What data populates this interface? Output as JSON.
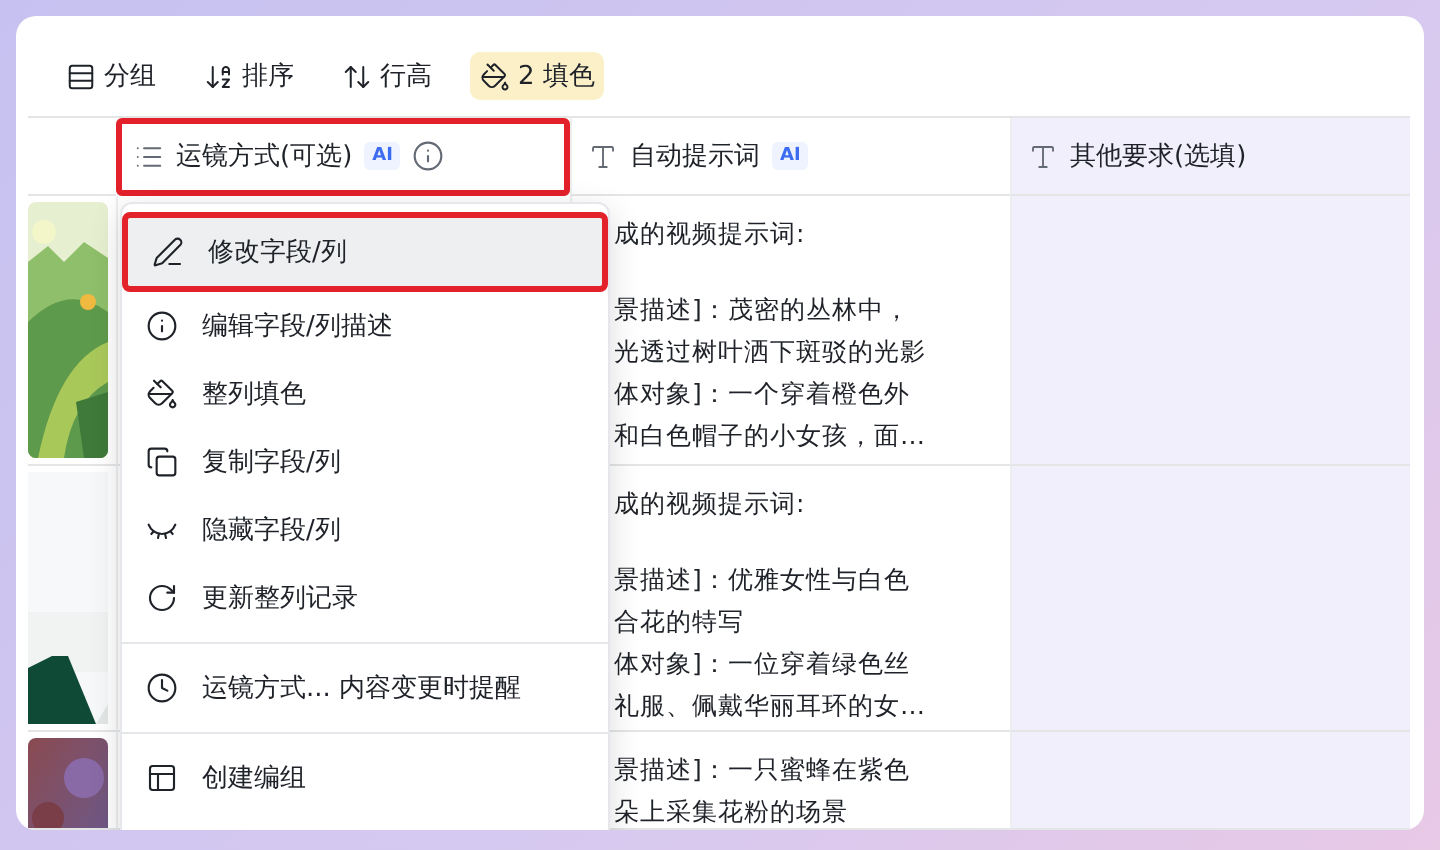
{
  "toolbar": [
    {
      "label": "分组",
      "kind": "group",
      "active": false
    },
    {
      "label": "排序",
      "kind": "sort",
      "active": false
    },
    {
      "label": "行高",
      "kind": "height",
      "active": false
    },
    {
      "label": "2 填色",
      "kind": "fill",
      "active": true
    }
  ],
  "columns": [
    {
      "label": "运镜方式(可选)",
      "kind": "options",
      "badge": "AI",
      "info": true,
      "annotated": true,
      "tinted": false
    },
    {
      "label": "自动提示词",
      "kind": "text",
      "badge": "AI",
      "info": false,
      "annotated": false,
      "tinted": false
    },
    {
      "label": "其他要求(选填)",
      "kind": "text",
      "info": false,
      "annotated": false,
      "tinted": true
    }
  ],
  "rows": [
    {
      "thumbnail": {
        "kind": "picture"
      },
      "prompt": [
        [
          "成的视频提示词:"
        ],
        [
          "景描述]：茂密的丛林中，",
          "光透过树叶洒下斑驳的光影",
          "体对象]：一个穿着橙色外",
          "和白色帽子的小女孩，面…"
        ]
      ]
    },
    {
      "thumbnail": {
        "kind": "picture"
      },
      "prompt": [
        [
          "成的视频提示词:"
        ],
        [
          "景描述]：优雅女性与白色",
          "合花的特写",
          "体对象]：一位穿着绿色丝",
          "礼服、佩戴华丽耳环的女…"
        ]
      ]
    },
    {
      "thumbnail": {
        "kind": "picture"
      },
      "prompt": [
        [
          "景描述]：一只蜜蜂在紫色",
          "朵上采集花粉的场景"
        ]
      ]
    }
  ],
  "menu": {
    "items": [
      {
        "label": "修改字段/列",
        "kind": "edit",
        "highlighted": true,
        "annotated": true,
        "divider_before": false
      },
      {
        "label": "编辑字段/列描述",
        "kind": "info",
        "highlighted": false,
        "annotated": false,
        "divider_before": false
      },
      {
        "label": "整列填色",
        "kind": "fill",
        "highlighted": false,
        "annotated": false,
        "divider_before": false
      },
      {
        "label": "复制字段/列",
        "kind": "copy",
        "highlighted": false,
        "annotated": false,
        "divider_before": false
      },
      {
        "label": "隐藏字段/列",
        "kind": "hide",
        "highlighted": false,
        "annotated": false,
        "divider_before": false
      },
      {
        "label": "更新整列记录",
        "kind": "refresh",
        "highlighted": false,
        "annotated": false,
        "divider_before": false
      },
      {
        "label": "运镜方式... 内容变更时提醒",
        "kind": "remind",
        "highlighted": false,
        "annotated": false,
        "divider_before": true
      },
      {
        "label": "创建编组",
        "kind": "group",
        "highlighted": false,
        "annotated": false,
        "divider_before": true
      }
    ]
  }
}
